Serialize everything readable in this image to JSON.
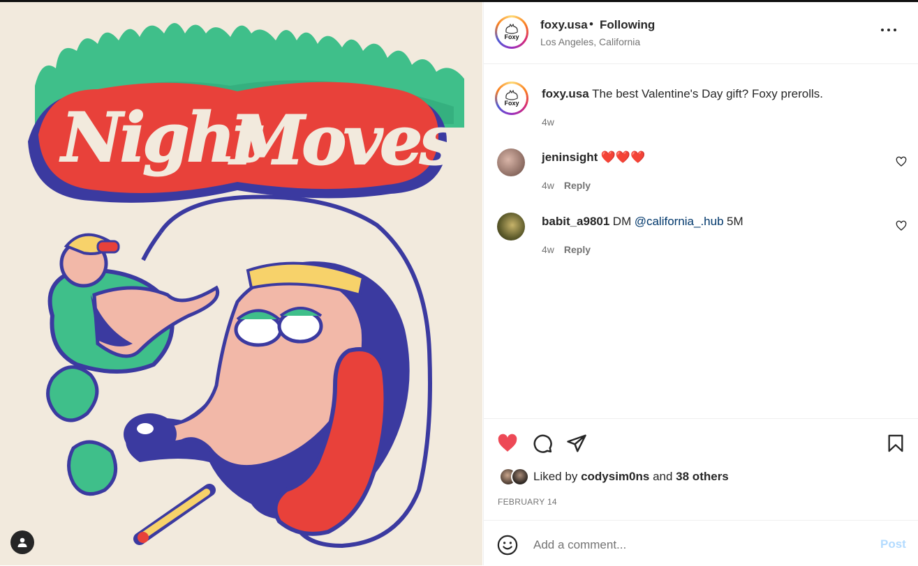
{
  "post": {
    "image": {
      "alt_lettering": "Night Moves"
    },
    "author": {
      "username": "foxy.usa",
      "follow_status": "Following",
      "location": "Los Angeles, California",
      "avatar_logo_text": "Foxy"
    },
    "caption": {
      "username": "foxy.usa",
      "text": "The best Valentine's Day gift? Foxy prerolls.",
      "age": "4w"
    },
    "comments": [
      {
        "username": "jeninsight",
        "text": "❤️❤️❤️",
        "age": "4w",
        "reply_label": "Reply"
      },
      {
        "username": "babit_a9801",
        "text_before": "DM",
        "mention": "@california_.hub",
        "text_after": "5M",
        "age": "4w",
        "reply_label": "Reply"
      }
    ],
    "likes": {
      "prefix": "Liked by",
      "user": "codysim0ns",
      "joiner": "and",
      "others": "38 others"
    },
    "date": "FEBRUARY 14",
    "add_comment": {
      "placeholder": "Add a comment...",
      "post_label": "Post"
    },
    "separator": "•",
    "colors": {
      "like_red": "#ed4956",
      "link": "#00376b",
      "post_disabled": "#b3dbff",
      "muted": "#737373"
    },
    "icons": [
      "heart-filled-icon",
      "comment-icon",
      "share-icon",
      "bookmark-icon",
      "more-icon",
      "emoji-icon",
      "user-tag-icon",
      "heart-outline-icon"
    ]
  }
}
